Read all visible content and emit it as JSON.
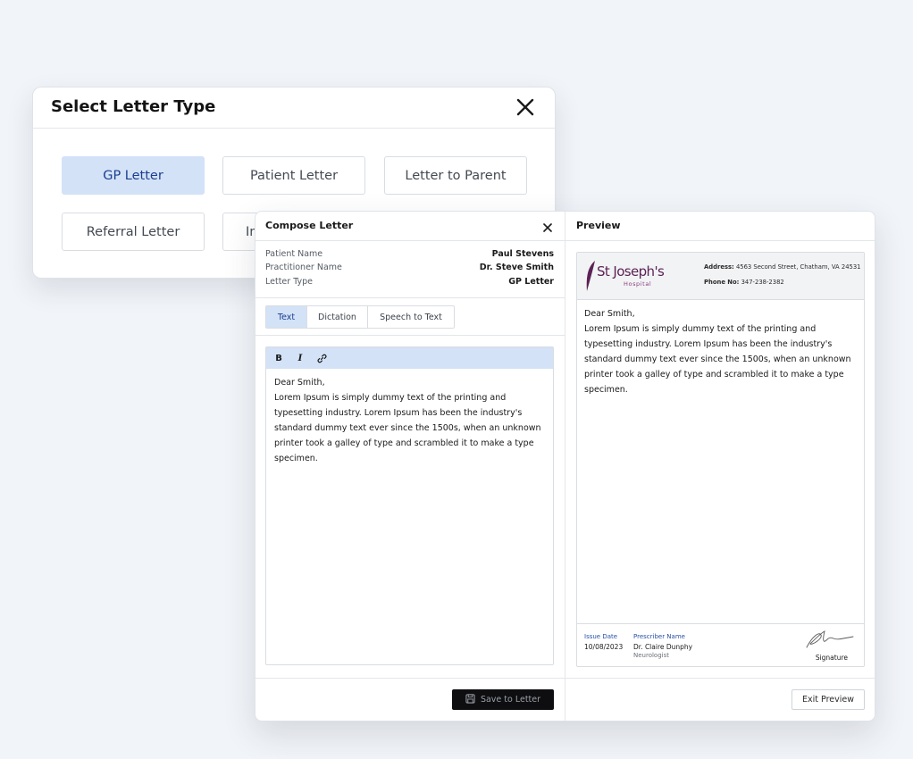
{
  "select_dialog": {
    "title": "Select Letter Type",
    "close_icon": "close-icon",
    "options": [
      {
        "label": "GP Letter",
        "selected": true
      },
      {
        "label": "Patient Letter",
        "selected": false
      },
      {
        "label": "Letter to Parent",
        "selected": false
      },
      {
        "label": "Referral Letter",
        "selected": false
      },
      {
        "label": "In",
        "selected": false
      }
    ]
  },
  "compose": {
    "title": "Compose Letter",
    "close_icon": "close-icon",
    "fields": [
      {
        "label": "Patient Name",
        "value": "Paul Stevens"
      },
      {
        "label": "Practitioner Name",
        "value": "Dr. Steve Smith"
      },
      {
        "label": "Letter Type",
        "value": "GP Letter"
      }
    ],
    "tabs": [
      {
        "label": "Text",
        "active": true
      },
      {
        "label": "Dictation",
        "active": false
      },
      {
        "label": "Speech to Text",
        "active": false
      }
    ],
    "toolbar": {
      "bold": "B",
      "italic": "I",
      "link_icon": "link-icon"
    },
    "body": {
      "greeting": "Dear Smith,",
      "text": "Lorem Ipsum is simply dummy text of the printing and typesetting industry. Lorem Ipsum has been the industry's standard dummy text ever since the 1500s, when an unknown printer took a galley of type and scrambled it to make a type specimen."
    },
    "save_label": "Save to Letter",
    "save_icon": "save-icon"
  },
  "preview": {
    "title": "Preview",
    "hospital": {
      "name": "St Joseph's",
      "subtitle": "Hospital"
    },
    "address_label": "Address:",
    "address": "4563 Second Street, Chatham, VA 24531",
    "phone_label": "Phone No:",
    "phone": "347-238-2382",
    "greeting": "Dear Smith,",
    "text": "Lorem Ipsum is simply dummy text of the printing and typesetting industry. Lorem Ipsum has been the industry's standard dummy text ever since the 1500s, when an unknown printer took a galley of type and scrambled it to make a type specimen.",
    "issue_date_label": "Issue Date",
    "issue_date": "10/08/2023",
    "prescriber_label": "Prescriber Name",
    "prescriber_name": "Dr. Claire Dunphy",
    "prescriber_role": "Neurologist",
    "signature_label": "Signature",
    "exit_label": "Exit Preview"
  },
  "colors": {
    "accent_bg": "#d3e2f7",
    "accent_text": "#1b3f8f",
    "brand_purple": "#5b2256",
    "background": "#f1f4f8"
  }
}
